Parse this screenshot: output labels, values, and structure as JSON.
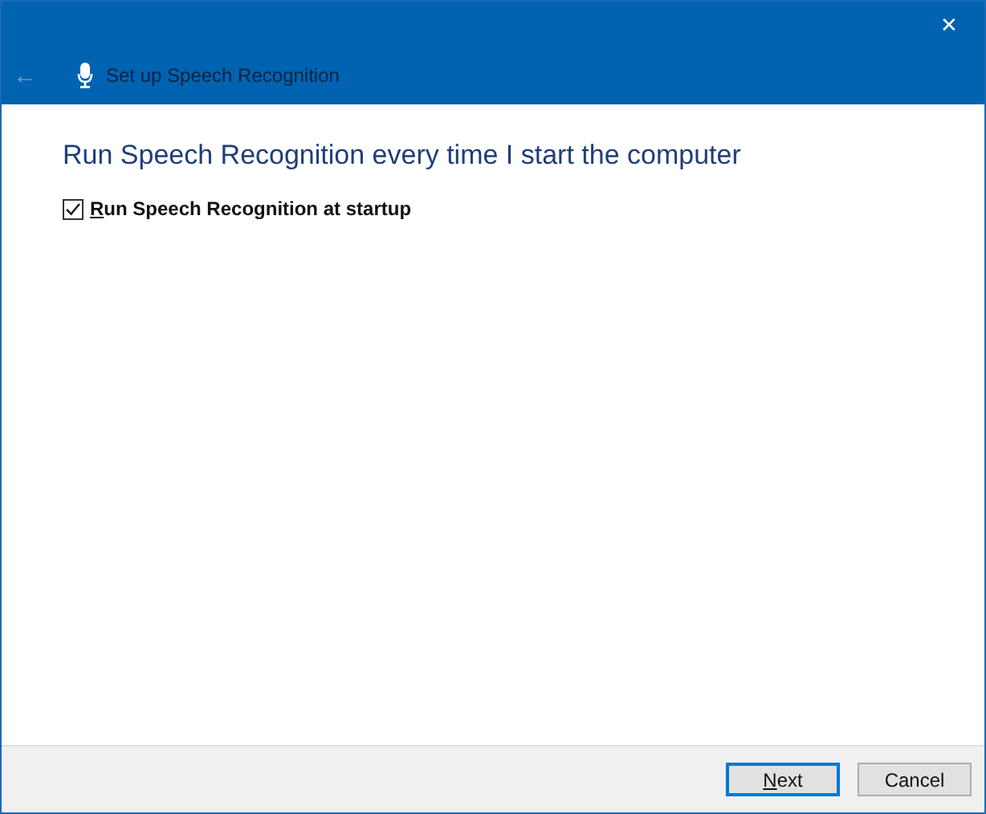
{
  "window": {
    "title": "Set up Speech Recognition",
    "close": "✕",
    "back": "←"
  },
  "heading": "Run Speech Recognition every time I start the computer",
  "checkbox": {
    "label": "Run Speech Recognition at startup",
    "checked": true,
    "access_key_underlined": true
  },
  "buttons": [
    {
      "label": "Next",
      "default": true,
      "access_key_underlined": true
    },
    {
      "label": "Cancel",
      "default": false,
      "access_key_underlined": false
    }
  ]
}
